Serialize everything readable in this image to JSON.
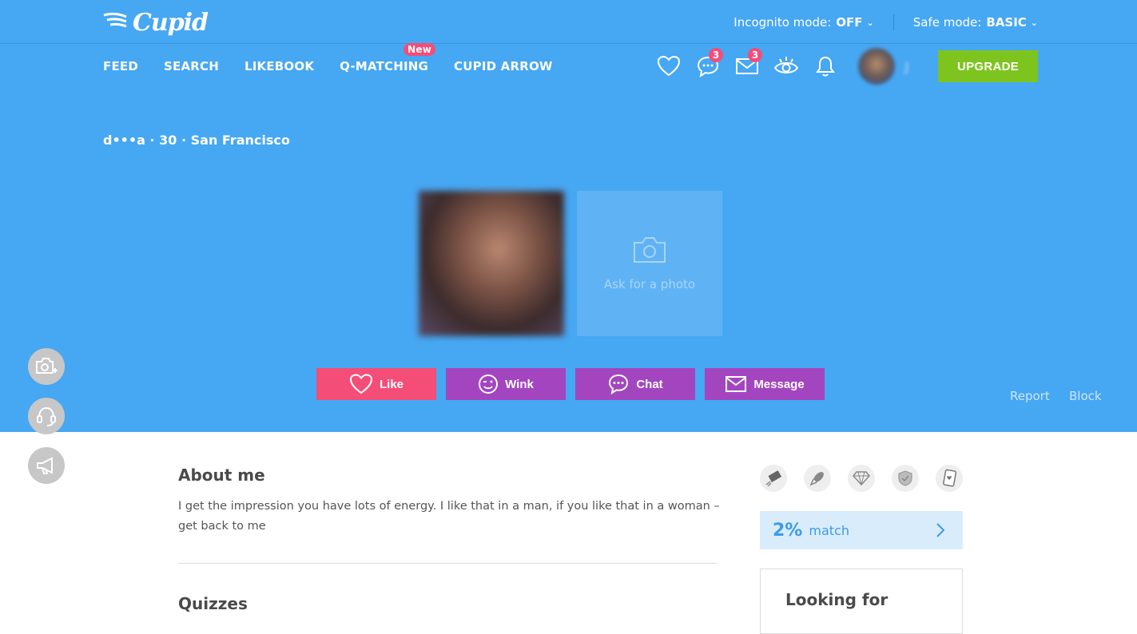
{
  "header": {
    "logo_text": "Cupid",
    "incognito": {
      "label": "Incognito mode:",
      "value": "OFF"
    },
    "safe": {
      "label": "Safe mode:",
      "value": "BASIC"
    }
  },
  "nav": {
    "items": [
      "FEED",
      "SEARCH",
      "LIKEBOOK",
      "Q-MATCHING",
      "CUPID ARROW"
    ],
    "new_badge": "New"
  },
  "icons": {
    "chats_count": "3",
    "messages_count": "3"
  },
  "user": {
    "name_blurred": "J"
  },
  "upgrade_label": "UPGRADE",
  "profile": {
    "title": "d•••a · 30 · San Francisco"
  },
  "ask_photo_label": "Ask for a photo",
  "actions": {
    "like": "Like",
    "wink": "Wink",
    "chat": "Chat",
    "message": "Message"
  },
  "report_label": "Report",
  "block_label": "Block",
  "about": {
    "heading": "About me",
    "text": "I get the impression you have lots of energy. I like that in a man, if you like that in a woman – get back to me"
  },
  "quizzes_heading": "Quizzes",
  "match": {
    "percent": "2%",
    "label": "match"
  },
  "looking_for_heading": "Looking for",
  "colors": {
    "hero": "#46a7f3",
    "like": "#f44d78",
    "purple": "#a445c0",
    "upgrade": "#7ec41e",
    "badge": "#f44d78"
  }
}
